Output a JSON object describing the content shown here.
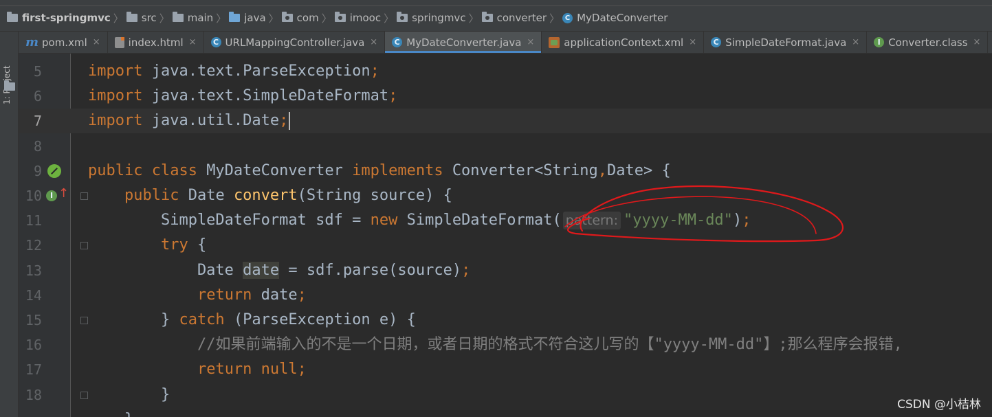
{
  "breadcrumb": {
    "items": [
      {
        "label": "first-springmvc",
        "icon": "folder-icon"
      },
      {
        "label": "src",
        "icon": "folder-icon"
      },
      {
        "label": "main",
        "icon": "folder-icon"
      },
      {
        "label": "java",
        "icon": "source-folder-icon"
      },
      {
        "label": "com",
        "icon": "package-icon"
      },
      {
        "label": "imooc",
        "icon": "package-icon"
      },
      {
        "label": "springmvc",
        "icon": "package-icon"
      },
      {
        "label": "converter",
        "icon": "package-icon"
      },
      {
        "label": "MyDateConverter",
        "icon": "class-icon"
      }
    ]
  },
  "sidebar": {
    "project_label": "1: Project"
  },
  "tabs": [
    {
      "label": "pom.xml",
      "icon": "maven-icon",
      "active": false,
      "icon_glyph": "m"
    },
    {
      "label": "index.html",
      "icon": "html-file-icon",
      "active": false,
      "icon_glyph": ""
    },
    {
      "label": "URLMappingController.java",
      "icon": "class-icon",
      "active": false,
      "icon_glyph": "C"
    },
    {
      "label": "MyDateConverter.java",
      "icon": "class-icon",
      "active": true,
      "icon_glyph": "C"
    },
    {
      "label": "applicationContext.xml",
      "icon": "spring-xml-icon",
      "active": false,
      "icon_glyph": ""
    },
    {
      "label": "SimpleDateFormat.java",
      "icon": "class-icon",
      "active": false,
      "icon_glyph": "C"
    },
    {
      "label": "Converter.class",
      "icon": "interface-icon",
      "active": false,
      "icon_glyph": "I"
    },
    {
      "label": "",
      "icon": "class-icon",
      "active": false,
      "icon_glyph": "C"
    }
  ],
  "tab_close_glyph": "×",
  "editor": {
    "current_line": 7,
    "lines": [
      {
        "n": "5",
        "segs": [
          {
            "t": "import ",
            "c": "kw"
          },
          {
            "t": "java.text.ParseException"
          },
          {
            "t": ";",
            "c": "kw"
          }
        ]
      },
      {
        "n": "6",
        "segs": [
          {
            "t": "import ",
            "c": "kw"
          },
          {
            "t": "java.text.SimpleDateFormat"
          },
          {
            "t": ";",
            "c": "kw"
          }
        ]
      },
      {
        "n": "7",
        "segs": [
          {
            "t": "import ",
            "c": "kw"
          },
          {
            "t": "java.util.Date"
          },
          {
            "t": ";",
            "c": "kw"
          }
        ]
      },
      {
        "n": "8",
        "segs": []
      },
      {
        "n": "9",
        "segs": [
          {
            "t": "public class ",
            "c": "kw"
          },
          {
            "t": "MyDateConverter "
          },
          {
            "t": "implements ",
            "c": "kw"
          },
          {
            "t": "Converter<String"
          },
          {
            "t": ",",
            "c": "kw"
          },
          {
            "t": "Date> {"
          }
        ]
      },
      {
        "n": "10",
        "segs": [
          {
            "t": "    "
          },
          {
            "t": "public ",
            "c": "kw"
          },
          {
            "t": "Date "
          },
          {
            "t": "convert",
            "c": "fn"
          },
          {
            "t": "(String source) {"
          }
        ]
      },
      {
        "n": "11",
        "segs": [
          {
            "t": "        SimpleDateFormat sdf = "
          },
          {
            "t": "new ",
            "c": "kw"
          },
          {
            "t": "SimpleDateFormat("
          },
          {
            "t": "pattern:",
            "c": "hint"
          },
          {
            "t": "\"yyyy-MM-dd\"",
            "c": "str"
          },
          {
            "t": ")"
          },
          {
            "t": ";",
            "c": "kw"
          }
        ]
      },
      {
        "n": "12",
        "segs": [
          {
            "t": "        "
          },
          {
            "t": "try ",
            "c": "kw"
          },
          {
            "t": "{"
          }
        ]
      },
      {
        "n": "13",
        "segs": [
          {
            "t": "            Date "
          },
          {
            "t": "date",
            "c": "usage"
          },
          {
            "t": " = sdf.parse(source)"
          },
          {
            "t": ";",
            "c": "kw"
          }
        ]
      },
      {
        "n": "14",
        "segs": [
          {
            "t": "            "
          },
          {
            "t": "return ",
            "c": "kw"
          },
          {
            "t": "date"
          },
          {
            "t": ";",
            "c": "kw"
          }
        ]
      },
      {
        "n": "15",
        "segs": [
          {
            "t": "        } "
          },
          {
            "t": "catch ",
            "c": "kw"
          },
          {
            "t": "(ParseException e) {"
          }
        ]
      },
      {
        "n": "16",
        "segs": [
          {
            "t": "            "
          },
          {
            "t": "//如果前端输入的不是一个日期，或者日期的格式不符合这儿写的【\"yyyy-MM-dd\"】;那么程序会报错,",
            "c": "cmt"
          }
        ]
      },
      {
        "n": "17",
        "segs": [
          {
            "t": "            "
          },
          {
            "t": "return null",
            "c": "kw"
          },
          {
            "t": ";",
            "c": "kw"
          }
        ]
      },
      {
        "n": "18",
        "segs": [
          {
            "t": "        }"
          }
        ]
      },
      {
        "n": "",
        "segs": [
          {
            "t": "    }"
          }
        ]
      }
    ]
  },
  "gutter_icons": {
    "line9": "spring-bean-icon",
    "line10": "implements-method-icon",
    "line10_glyph": "I",
    "line10_arrow": "↑"
  },
  "annotation": {
    "color": "#e0191b",
    "shape": "hand-drawn-ellipse"
  },
  "watermark": "CSDN @小桔林",
  "colors": {
    "background": "#2b2b2b",
    "keyword": "#cc7832",
    "function": "#ffc66d",
    "string": "#6a8759",
    "comment": "#808080",
    "plain": "#a9b7c6",
    "active_tab_underline": "#4a88c7"
  }
}
